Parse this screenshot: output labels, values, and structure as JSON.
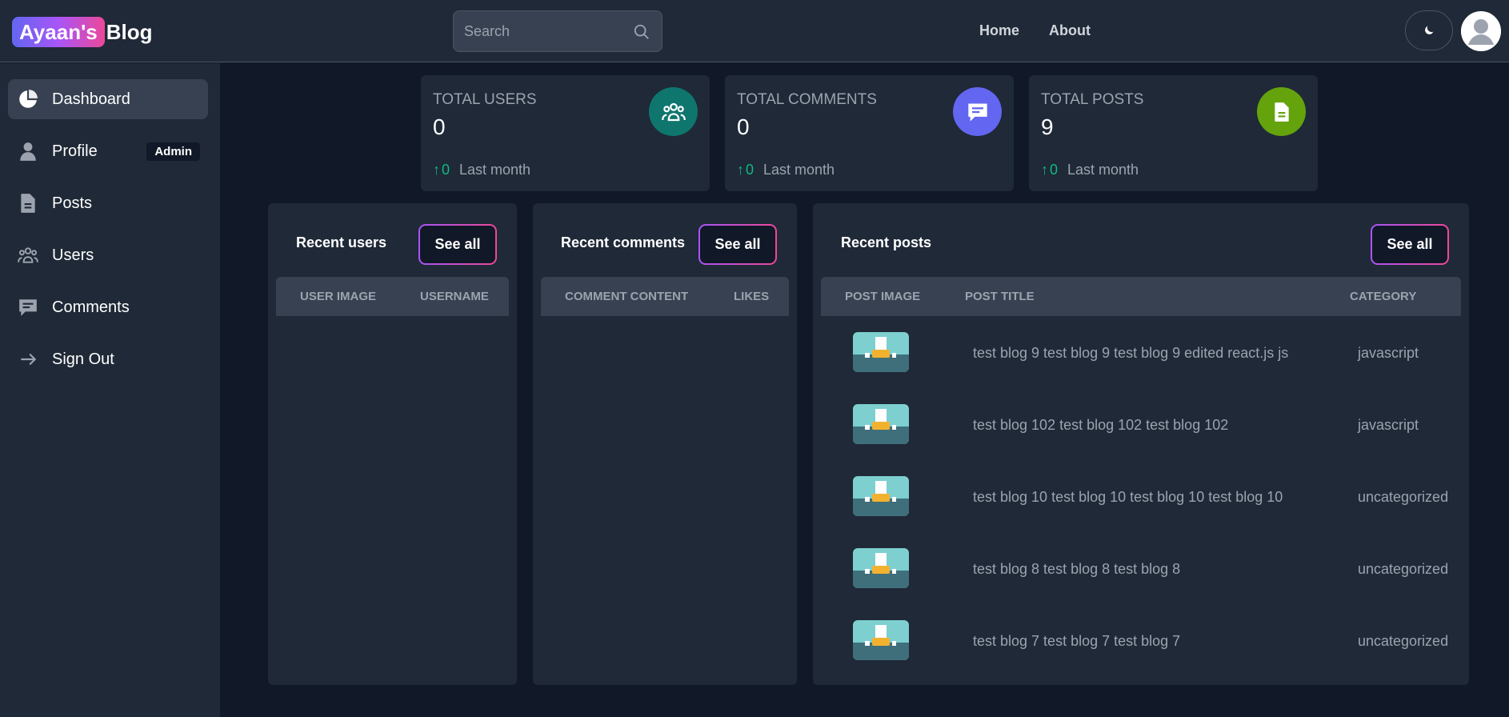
{
  "header": {
    "brand_highlight": "Ayaan's",
    "brand_rest": "Blog",
    "search_placeholder": "Search",
    "nav": [
      "Home",
      "About"
    ]
  },
  "sidebar": {
    "items": [
      {
        "label": "Dashboard",
        "icon": "pie-chart-icon",
        "active": true
      },
      {
        "label": "Profile",
        "icon": "user-icon",
        "badge": "Admin"
      },
      {
        "label": "Posts",
        "icon": "document-icon"
      },
      {
        "label": "Users",
        "icon": "users-group-icon"
      },
      {
        "label": "Comments",
        "icon": "comment-icon"
      },
      {
        "label": "Sign Out",
        "icon": "arrow-right-icon"
      }
    ]
  },
  "stats": [
    {
      "title": "TOTAL USERS",
      "value": "0",
      "delta": "0",
      "period": "Last month",
      "icon": "users-group-icon",
      "color": "#0f766e"
    },
    {
      "title": "TOTAL COMMENTS",
      "value": "0",
      "delta": "0",
      "period": "Last month",
      "icon": "comment-icon",
      "color": "#6366f1"
    },
    {
      "title": "TOTAL POSTS",
      "value": "9",
      "delta": "0",
      "period": "Last month",
      "icon": "document-icon",
      "color": "#65a30d"
    }
  ],
  "recent_users": {
    "title": "Recent users",
    "see_all": "See all",
    "columns": [
      "USER IMAGE",
      "USERNAME"
    ]
  },
  "recent_comments": {
    "title": "Recent comments",
    "see_all": "See all",
    "columns": [
      "COMMENT CONTENT",
      "LIKES"
    ]
  },
  "recent_posts": {
    "title": "Recent posts",
    "see_all": "See all",
    "columns": [
      "POST IMAGE",
      "POST TITLE",
      "CATEGORY"
    ],
    "rows": [
      {
        "title": "test blog 9 test blog 9 test blog 9 edited react.js js",
        "category": "javascript"
      },
      {
        "title": "test blog 102 test blog 102 test blog 102",
        "category": "javascript"
      },
      {
        "title": "test blog 10 test blog 10 test blog 10 test blog 10",
        "category": "uncategorized"
      },
      {
        "title": "test blog 8 test blog 8 test blog 8",
        "category": "uncategorized"
      },
      {
        "title": "test blog 7 test blog 7 test blog 7",
        "category": "uncategorized"
      }
    ]
  }
}
